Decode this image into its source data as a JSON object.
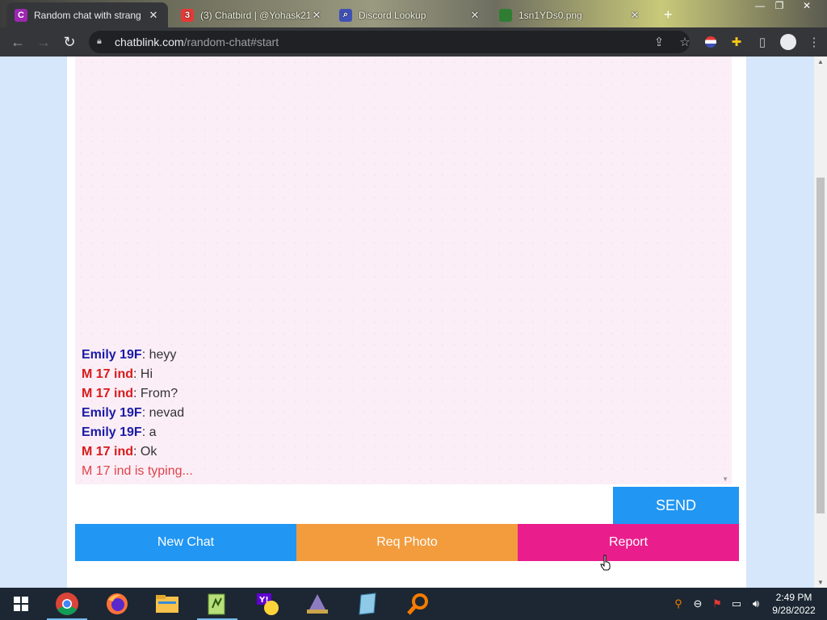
{
  "browser": {
    "tabs": [
      {
        "title": "Random chat with strang",
        "close": "✕",
        "favicon_letter": "C",
        "favicon_color": "#9c27b0",
        "active": true
      },
      {
        "title": "(3) Chatbird | @Yohask21",
        "close": "✕",
        "favicon_color": "#e53935",
        "badge": "3"
      },
      {
        "title": "Discord Lookup",
        "close": "✕",
        "favicon_color": "#3f51b5"
      },
      {
        "title": "1sn1YDs0.png",
        "close": "✕",
        "favicon_color": "#2e7d32"
      }
    ],
    "new_tab": "+",
    "url_host": "chatblink.com",
    "url_path": "/random-chat#start"
  },
  "chat": {
    "messages": [
      {
        "nick": "Emily 19F",
        "sep": ": ",
        "text": "heyy",
        "who": "her"
      },
      {
        "nick": "M 17 ind",
        "sep": ": ",
        "text": "Hi",
        "who": "him"
      },
      {
        "nick": "M 17 ind",
        "sep": ": ",
        "text": "From?",
        "who": "him"
      },
      {
        "nick": "Emily 19F",
        "sep": ": ",
        "text": "nevad",
        "who": "her"
      },
      {
        "nick": "Emily 19F",
        "sep": ": ",
        "text": "a",
        "who": "her"
      },
      {
        "nick": "M 17 ind",
        "sep": ": ",
        "text": "Ok",
        "who": "him"
      }
    ],
    "typing": "M 17 ind is typing...",
    "input_value": "",
    "send_label": "SEND",
    "actions": {
      "new_chat": "New Chat",
      "req_photo": "Req Photo",
      "report": "Report"
    },
    "colors": {
      "her": "#1a1aa6",
      "him": "#d81b1b",
      "send": "#2196f3",
      "new_chat": "#2196f3",
      "req_photo": "#f39c3d",
      "report": "#e91e8c"
    }
  },
  "taskbar": {
    "apps": [
      "chrome",
      "firefox",
      "file-explorer",
      "notepad-plus",
      "yahoo-messenger",
      "wizard-app",
      "notes-app",
      "search-app"
    ],
    "clock_time": "2:49 PM",
    "clock_date": "9/28/2022"
  }
}
